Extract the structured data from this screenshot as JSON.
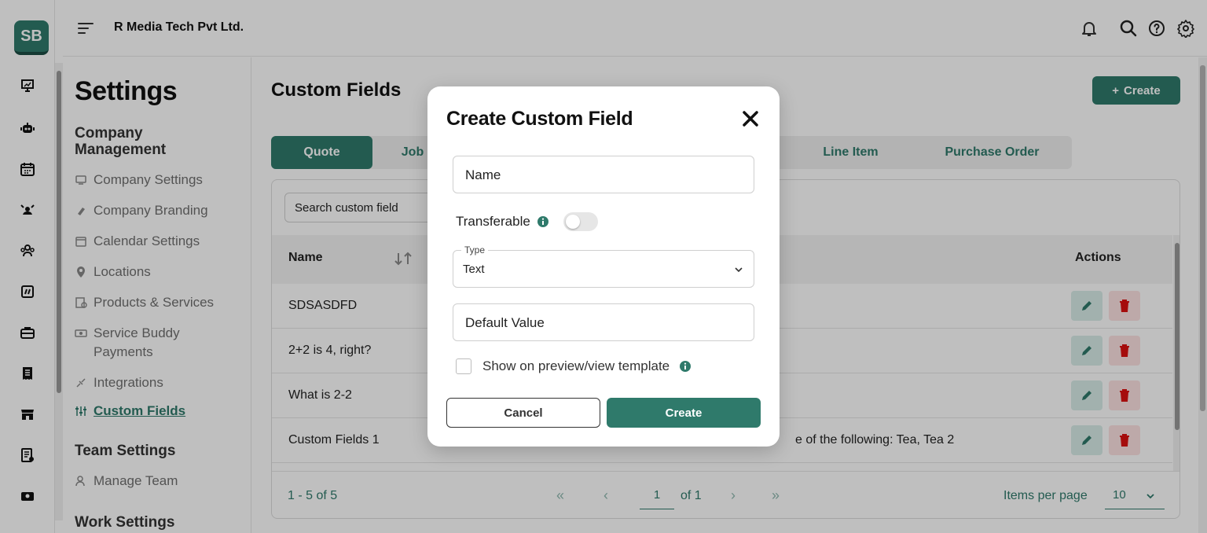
{
  "brand": {
    "logo_text": "SB",
    "accent": "#2f7a6b"
  },
  "header": {
    "company_name": "R Media Tech Pvt Ltd."
  },
  "rail_icons": [
    "presentation-icon",
    "bot-icon",
    "calendar-icon",
    "team-icon",
    "users-icon",
    "dashboard-icon",
    "briefcase-icon",
    "receipt-icon",
    "store-icon",
    "invoice-icon",
    "payment-icon"
  ],
  "settings": {
    "title": "Settings",
    "company_section": "Company Management",
    "items": [
      {
        "label": "Company Settings"
      },
      {
        "label": "Company Branding"
      },
      {
        "label": "Calendar Settings"
      },
      {
        "label": "Locations"
      },
      {
        "label": "Products & Services"
      },
      {
        "label": "Service Buddy Payments"
      },
      {
        "label": "Integrations"
      },
      {
        "label": "Custom Fields"
      }
    ],
    "team_section": "Team Settings",
    "team_items": [
      {
        "label": "Manage Team"
      }
    ],
    "work_section": "Work Settings"
  },
  "page": {
    "title": "Custom Fields",
    "create_label": "Create",
    "tabs": [
      {
        "label": "Quote"
      },
      {
        "label": "Job"
      },
      {
        "label": "Line Item"
      },
      {
        "label": "Purchase Order"
      }
    ],
    "search_placeholder": "Search custom field",
    "table": {
      "col_name": "Name",
      "col_actions": "Actions",
      "rows": [
        {
          "name": "SDSASDFD",
          "detail": ""
        },
        {
          "name": "2+2 is 4, right?",
          "detail": ""
        },
        {
          "name": "What is 2-2",
          "detail": ""
        },
        {
          "name": "Custom Fields 1",
          "detail": "e of the following: Tea, Tea 2"
        }
      ]
    },
    "pager": {
      "range": "1 - 5 of 5",
      "page": "1",
      "of": "of 1",
      "items_label": "Items per page",
      "items_value": "10"
    }
  },
  "modal": {
    "title": "Create Custom Field",
    "name_placeholder": "Name",
    "transferable_label": "Transferable",
    "type_label": "Type",
    "type_value": "Text",
    "default_placeholder": "Default Value",
    "show_label": "Show on preview/view template",
    "cancel_label": "Cancel",
    "create_label": "Create"
  }
}
